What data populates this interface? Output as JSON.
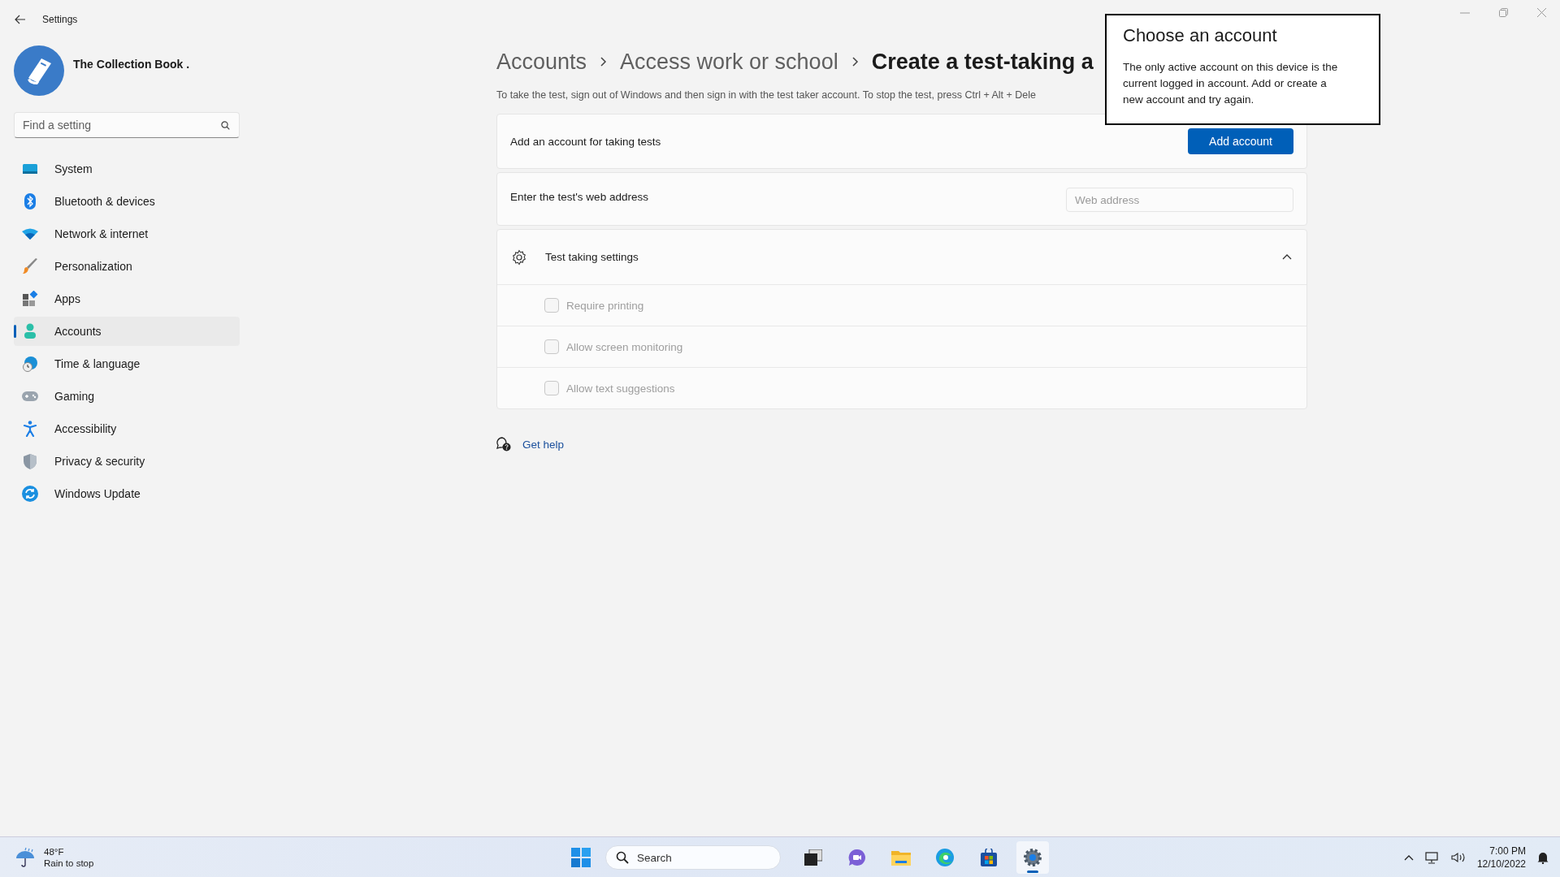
{
  "window": {
    "title": "Settings"
  },
  "profile": {
    "name": "The Collection Book ."
  },
  "search": {
    "placeholder": "Find a setting"
  },
  "nav": [
    {
      "label": "System",
      "selected": false
    },
    {
      "label": "Bluetooth & devices",
      "selected": false
    },
    {
      "label": "Network & internet",
      "selected": false
    },
    {
      "label": "Personalization",
      "selected": false
    },
    {
      "label": "Apps",
      "selected": false
    },
    {
      "label": "Accounts",
      "selected": true
    },
    {
      "label": "Time & language",
      "selected": false
    },
    {
      "label": "Gaming",
      "selected": false
    },
    {
      "label": "Accessibility",
      "selected": false
    },
    {
      "label": "Privacy & security",
      "selected": false
    },
    {
      "label": "Windows Update",
      "selected": false
    }
  ],
  "breadcrumb": [
    "Accounts",
    "Access work or school",
    "Create a test-taking a"
  ],
  "description": "To take the test, sign out of Windows and then sign in with the test taker account. To stop the test, press Ctrl + Alt + Dele",
  "account_card": {
    "label": "Add an account for taking tests",
    "button": "Add account"
  },
  "address_card": {
    "label": "Enter the test's web address",
    "placeholder": "Web address"
  },
  "settings_group": {
    "title": "Test taking settings",
    "expanded": true,
    "options": [
      {
        "label": "Require printing",
        "checked": false,
        "disabled": true
      },
      {
        "label": "Allow screen monitoring",
        "checked": false,
        "disabled": true
      },
      {
        "label": "Allow text suggestions",
        "checked": false,
        "disabled": true
      }
    ]
  },
  "help_link": "Get help",
  "dialog": {
    "title": "Choose an account",
    "message": "The only active account on this device is the current logged in account. Add or create a new account and try again."
  },
  "taskbar": {
    "weather": {
      "temp": "48°F",
      "condition": "Rain to stop"
    },
    "search": {
      "placeholder": "Search"
    },
    "apps": [
      {
        "selected": false
      },
      {
        "selected": false
      },
      {
        "selected": false
      },
      {
        "selected": false
      },
      {
        "selected": false
      },
      {
        "selected": true
      }
    ],
    "clock": {
      "time": "7:00 PM",
      "date": "12/10/2022"
    }
  }
}
